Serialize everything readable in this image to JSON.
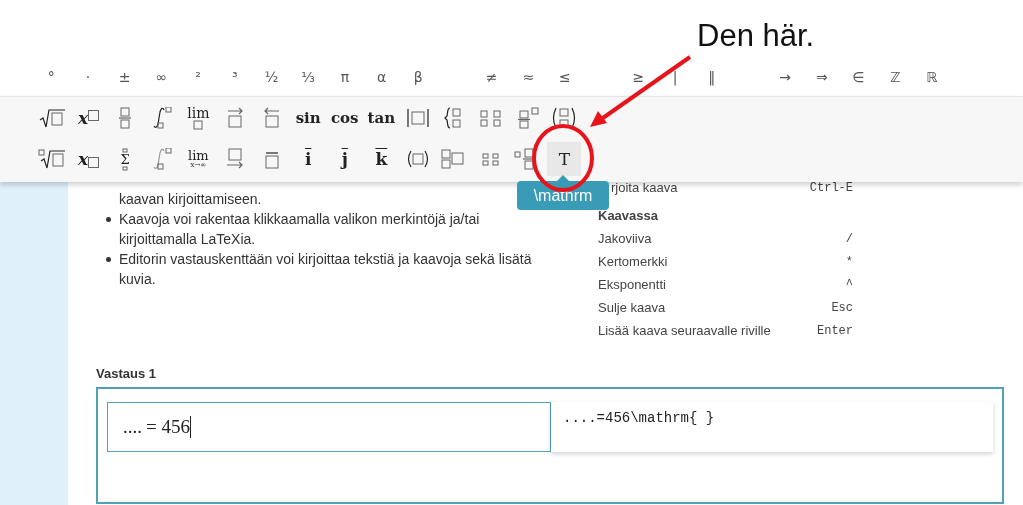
{
  "annotation": {
    "text": "Den här."
  },
  "symbol_groups": [
    [
      "°",
      "·",
      "±",
      "∞",
      "²",
      "³",
      "½",
      "⅓",
      "π",
      "α",
      "β"
    ],
    [
      "≠",
      "≈",
      "≤"
    ],
    [
      "≥",
      "|",
      "‖"
    ],
    [
      "→",
      "⇒",
      "∈",
      "ℤ",
      "ℝ"
    ]
  ],
  "toolbar_rows": [
    [
      {
        "kind": "sqrt",
        "highlighted": false
      },
      {
        "kind": "sup",
        "label": "x",
        "highlighted": false
      },
      {
        "kind": "frac",
        "highlighted": false
      },
      {
        "kind": "integral",
        "highlighted": false
      },
      {
        "kind": "lim",
        "label": "lim",
        "highlighted": false
      },
      {
        "kind": "vec-right",
        "highlighted": false
      },
      {
        "kind": "vec-left",
        "highlighted": false
      },
      {
        "kind": "func",
        "label": "sin",
        "highlighted": false
      },
      {
        "kind": "func",
        "label": "cos",
        "highlighted": false
      },
      {
        "kind": "func",
        "label": "tan",
        "highlighted": false
      },
      {
        "kind": "abs",
        "highlighted": false
      },
      {
        "kind": "cases",
        "highlighted": false
      },
      {
        "kind": "matrix",
        "highlighted": false
      },
      {
        "kind": "frac-power",
        "highlighted": false
      },
      {
        "kind": "binom",
        "highlighted": false
      }
    ],
    [
      {
        "kind": "nthroot",
        "highlighted": false
      },
      {
        "kind": "sub",
        "label": "x",
        "highlighted": false
      },
      {
        "kind": "sum",
        "label": "Σ",
        "highlighted": false
      },
      {
        "kind": "integral-limits",
        "highlighted": false
      },
      {
        "kind": "lim-sub",
        "label": "lim",
        "sub": "x→∞",
        "highlighted": false
      },
      {
        "kind": "under-arrow",
        "highlighted": false
      },
      {
        "kind": "overline",
        "highlighted": false
      },
      {
        "kind": "accent",
        "label": "i",
        "highlighted": false
      },
      {
        "kind": "accent",
        "label": "j",
        "highlighted": false
      },
      {
        "kind": "accent",
        "label": "k",
        "highlighted": false
      },
      {
        "kind": "parens",
        "highlighted": false
      },
      {
        "kind": "box-pair",
        "highlighted": false
      },
      {
        "kind": "matrix-small",
        "highlighted": false
      },
      {
        "kind": "partial-frac",
        "highlighted": false
      },
      {
        "kind": "text",
        "label": "T",
        "highlighted": true
      }
    ]
  ],
  "tooltip": {
    "text": "\\mathrm"
  },
  "instructions": [
    {
      "lines": "kaavan kirjoittamiseen.",
      "bullet_visible": false
    },
    {
      "lines": "Kaavoja voi rakentaa klikkaamalla valikon merkintöjä ja/tai kirjoittamalla LaTeXia.",
      "bullet_visible": true
    },
    {
      "lines": "Editorin vastauskenttään voi kirjoittaa tekstiä ja kaavoja sekä lisätä kuvia.",
      "bullet_visible": true
    }
  ],
  "shortcuts": [
    {
      "kind": "cut-row",
      "label": "rjoita kaava",
      "key": "Ctrl-E"
    },
    {
      "kind": "heading",
      "label": "Kaavassa"
    },
    {
      "kind": "row",
      "label": "Jakoviiva",
      "key": "/"
    },
    {
      "kind": "row",
      "label": "Kertomerkki",
      "key": "*"
    },
    {
      "kind": "row",
      "label": "Eksponentti",
      "key": "^"
    },
    {
      "kind": "row",
      "label": "Sulje kaava",
      "key": "Esc"
    },
    {
      "kind": "row",
      "label": "Lisää kaava seuraavalle riville",
      "key": "Enter"
    }
  ],
  "answer": {
    "label": "Vastaus 1",
    "formula_prefix": "....",
    "formula_rest": "= 456",
    "latex": "....=456\\mathrm{ }"
  }
}
